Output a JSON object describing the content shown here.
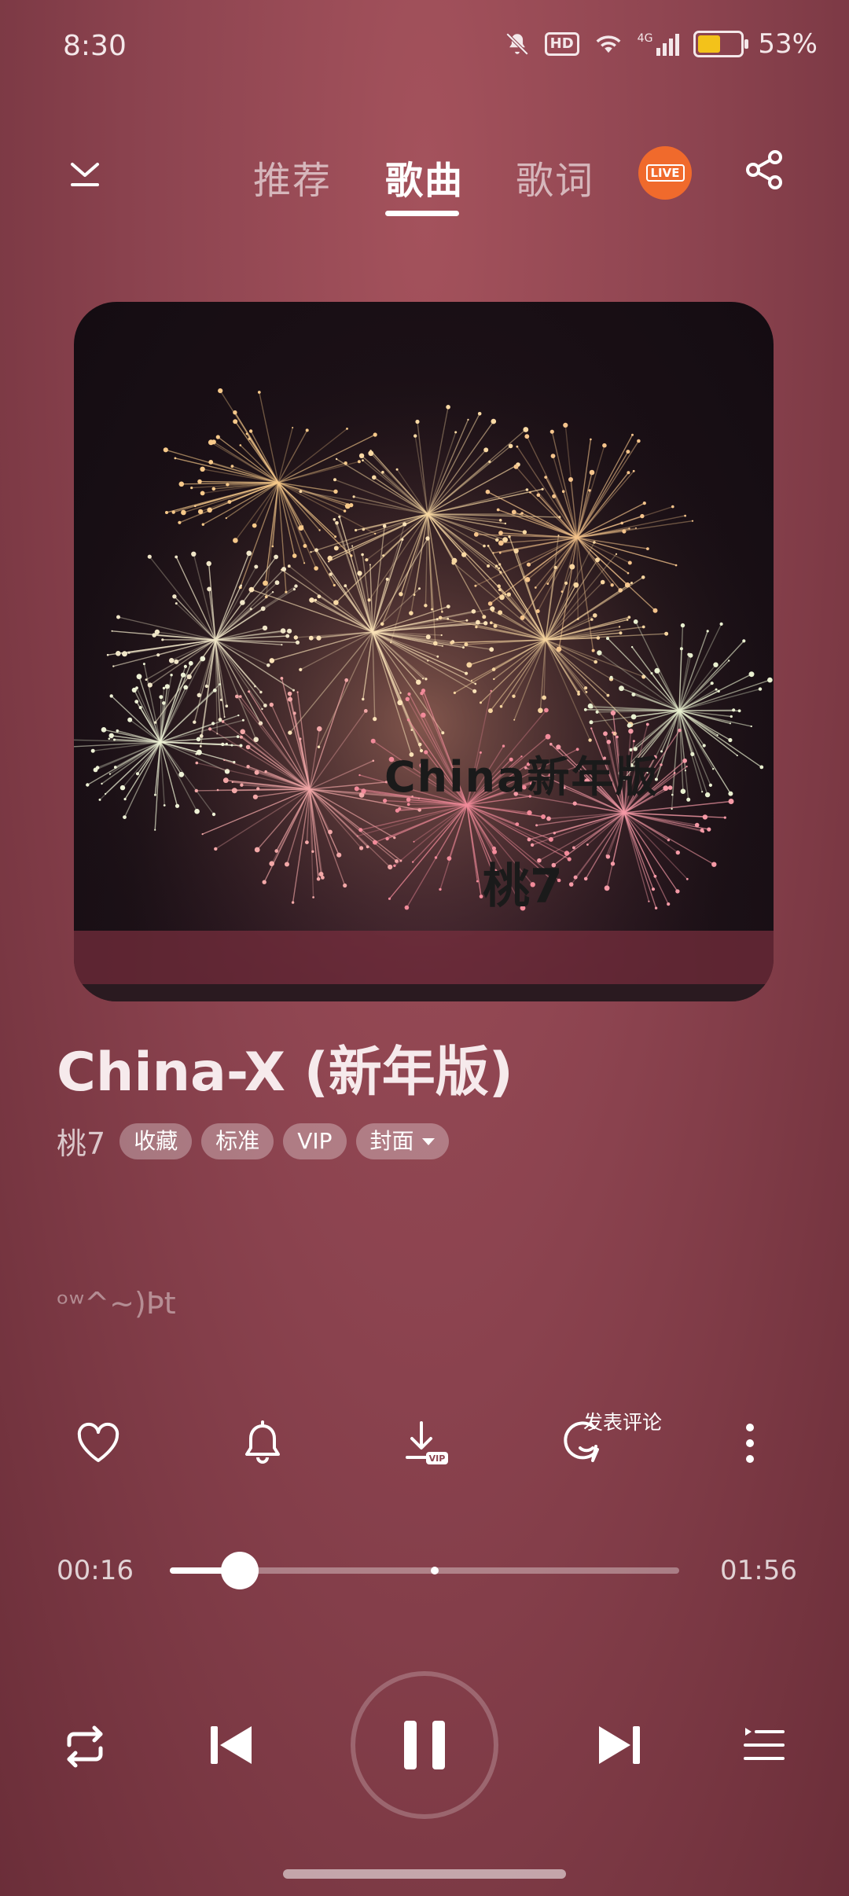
{
  "status_bar": {
    "time": "8:30",
    "hd_label": "HD",
    "network": "4G",
    "battery_percent": "53%",
    "battery_level": 0.53
  },
  "header": {
    "tabs": [
      {
        "label": "推荐"
      },
      {
        "label": "歌曲"
      },
      {
        "label": "歌词"
      }
    ],
    "active_tab": "歌曲",
    "live_label": "LIVE"
  },
  "cover": {
    "title_text": "China新年版",
    "artist_text": "桃7"
  },
  "song": {
    "title": "China-X (新年版)",
    "artist": "桃7",
    "tags": [
      {
        "label": "收藏"
      },
      {
        "label": "标准"
      },
      {
        "label": "VIP"
      },
      {
        "label": "封面"
      }
    ]
  },
  "lyrics": {
    "current_line": "ᵒʷ^~)Þt"
  },
  "actions": {
    "comment_label": "发表评论",
    "download_badge": "VIP"
  },
  "playback": {
    "current_time": "00:16",
    "total_time": "01:56",
    "progress": 0.138,
    "buffered": 0.52,
    "state": "playing"
  },
  "colors": {
    "live_accent": "#f06a2c",
    "battery_fill": "#f3c21a",
    "background_top": "#a4525c",
    "background_bottom": "#6b2e39"
  },
  "icons": [
    "collapse-down-icon",
    "live-icon",
    "share-icon",
    "heart-icon",
    "bell-icon",
    "download-icon",
    "comment-icon",
    "more-vertical-icon",
    "repeat-icon",
    "previous-icon",
    "pause-icon",
    "next-icon",
    "playlist-icon"
  ]
}
